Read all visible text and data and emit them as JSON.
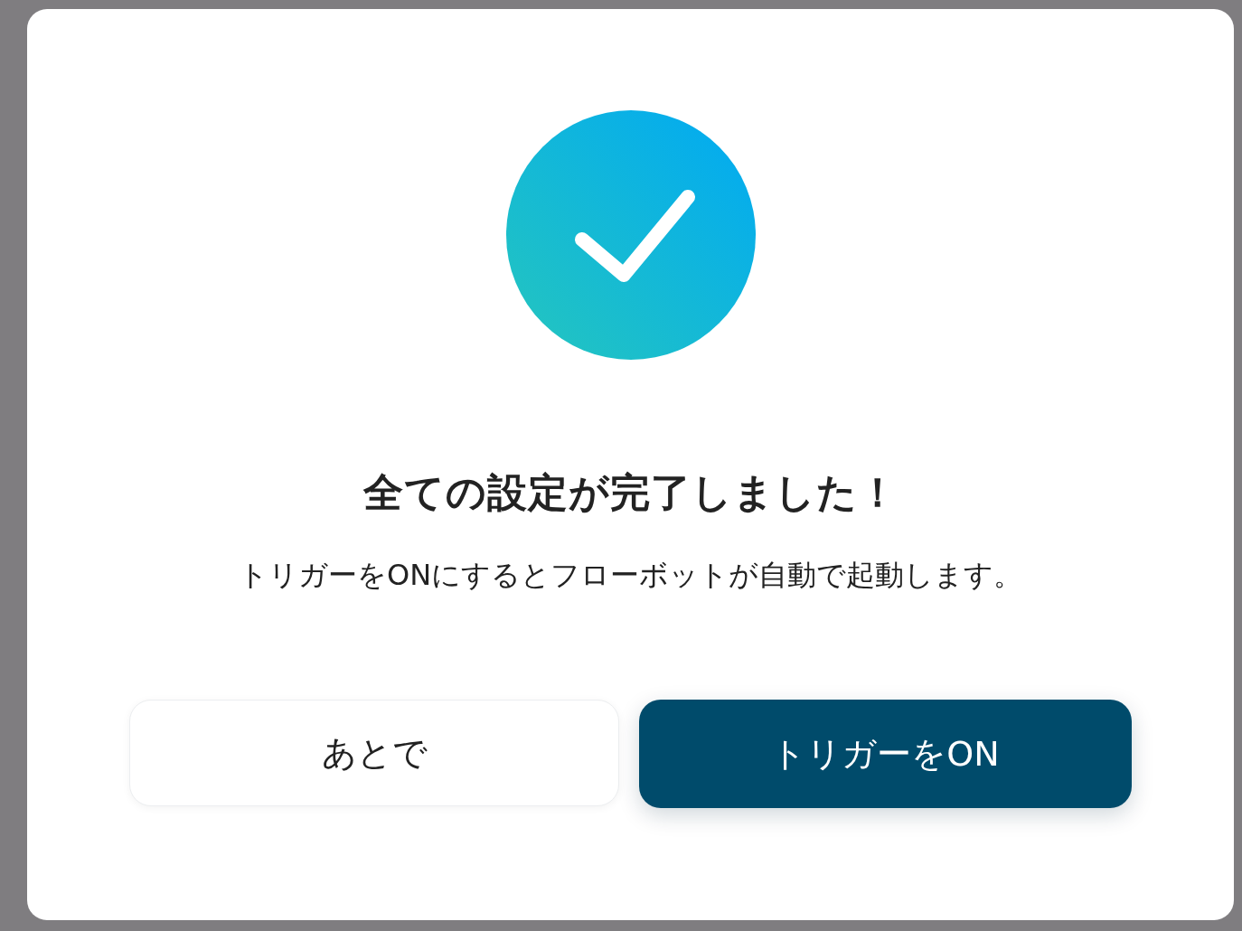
{
  "dialog": {
    "title": "全ての設定が完了しました！",
    "message": "トリガーをONにするとフローボットが自動で起動します。",
    "buttons": [
      {
        "label": "あとで",
        "kind": "secondary"
      },
      {
        "label": "トリガーをON",
        "kind": "primary"
      }
    ]
  }
}
